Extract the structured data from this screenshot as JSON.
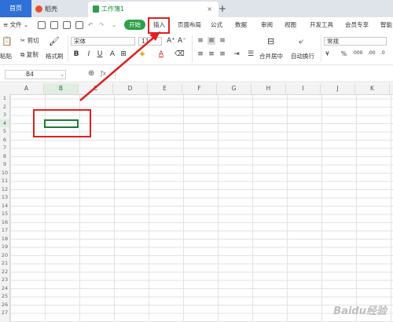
{
  "tabs": [
    {
      "label": "首页",
      "icon": "home-tab"
    },
    {
      "label": "稻壳",
      "icon": "docer-logo-icon"
    },
    {
      "label": "工作簿1",
      "icon": "sheet-icon"
    }
  ],
  "menu": {
    "file_label": "文件",
    "items": [
      "开始",
      "插入",
      "页面布局",
      "公式",
      "数据",
      "审阅",
      "视图",
      "开发工具",
      "会员专享",
      "智能"
    ]
  },
  "ribbon": {
    "cut": "剪切",
    "paste": "粘贴",
    "copy": "复制",
    "format_painter": "格式刷",
    "font_name": "宋体",
    "font_size": "11",
    "merge": "合并居中",
    "wrap": "自动换行",
    "number_format": "常规",
    "currency": "¥",
    "percent": "%"
  },
  "name_box": "B4",
  "columns": [
    "A",
    "B",
    "C",
    "D",
    "E",
    "F",
    "G",
    "H",
    "I",
    "J",
    "K"
  ],
  "rows": [
    "1",
    "2",
    "3",
    "4",
    "5",
    "6",
    "7",
    "8",
    "9",
    "10",
    "11",
    "12",
    "13",
    "14",
    "15",
    "16",
    "17",
    "18",
    "19",
    "20",
    "21",
    "22",
    "23",
    "24",
    "25",
    "26",
    "27"
  ],
  "annotations": {
    "highlight_color": "#e02020",
    "selection_color": "#1f7a3a"
  },
  "watermark": "Baidu经验"
}
